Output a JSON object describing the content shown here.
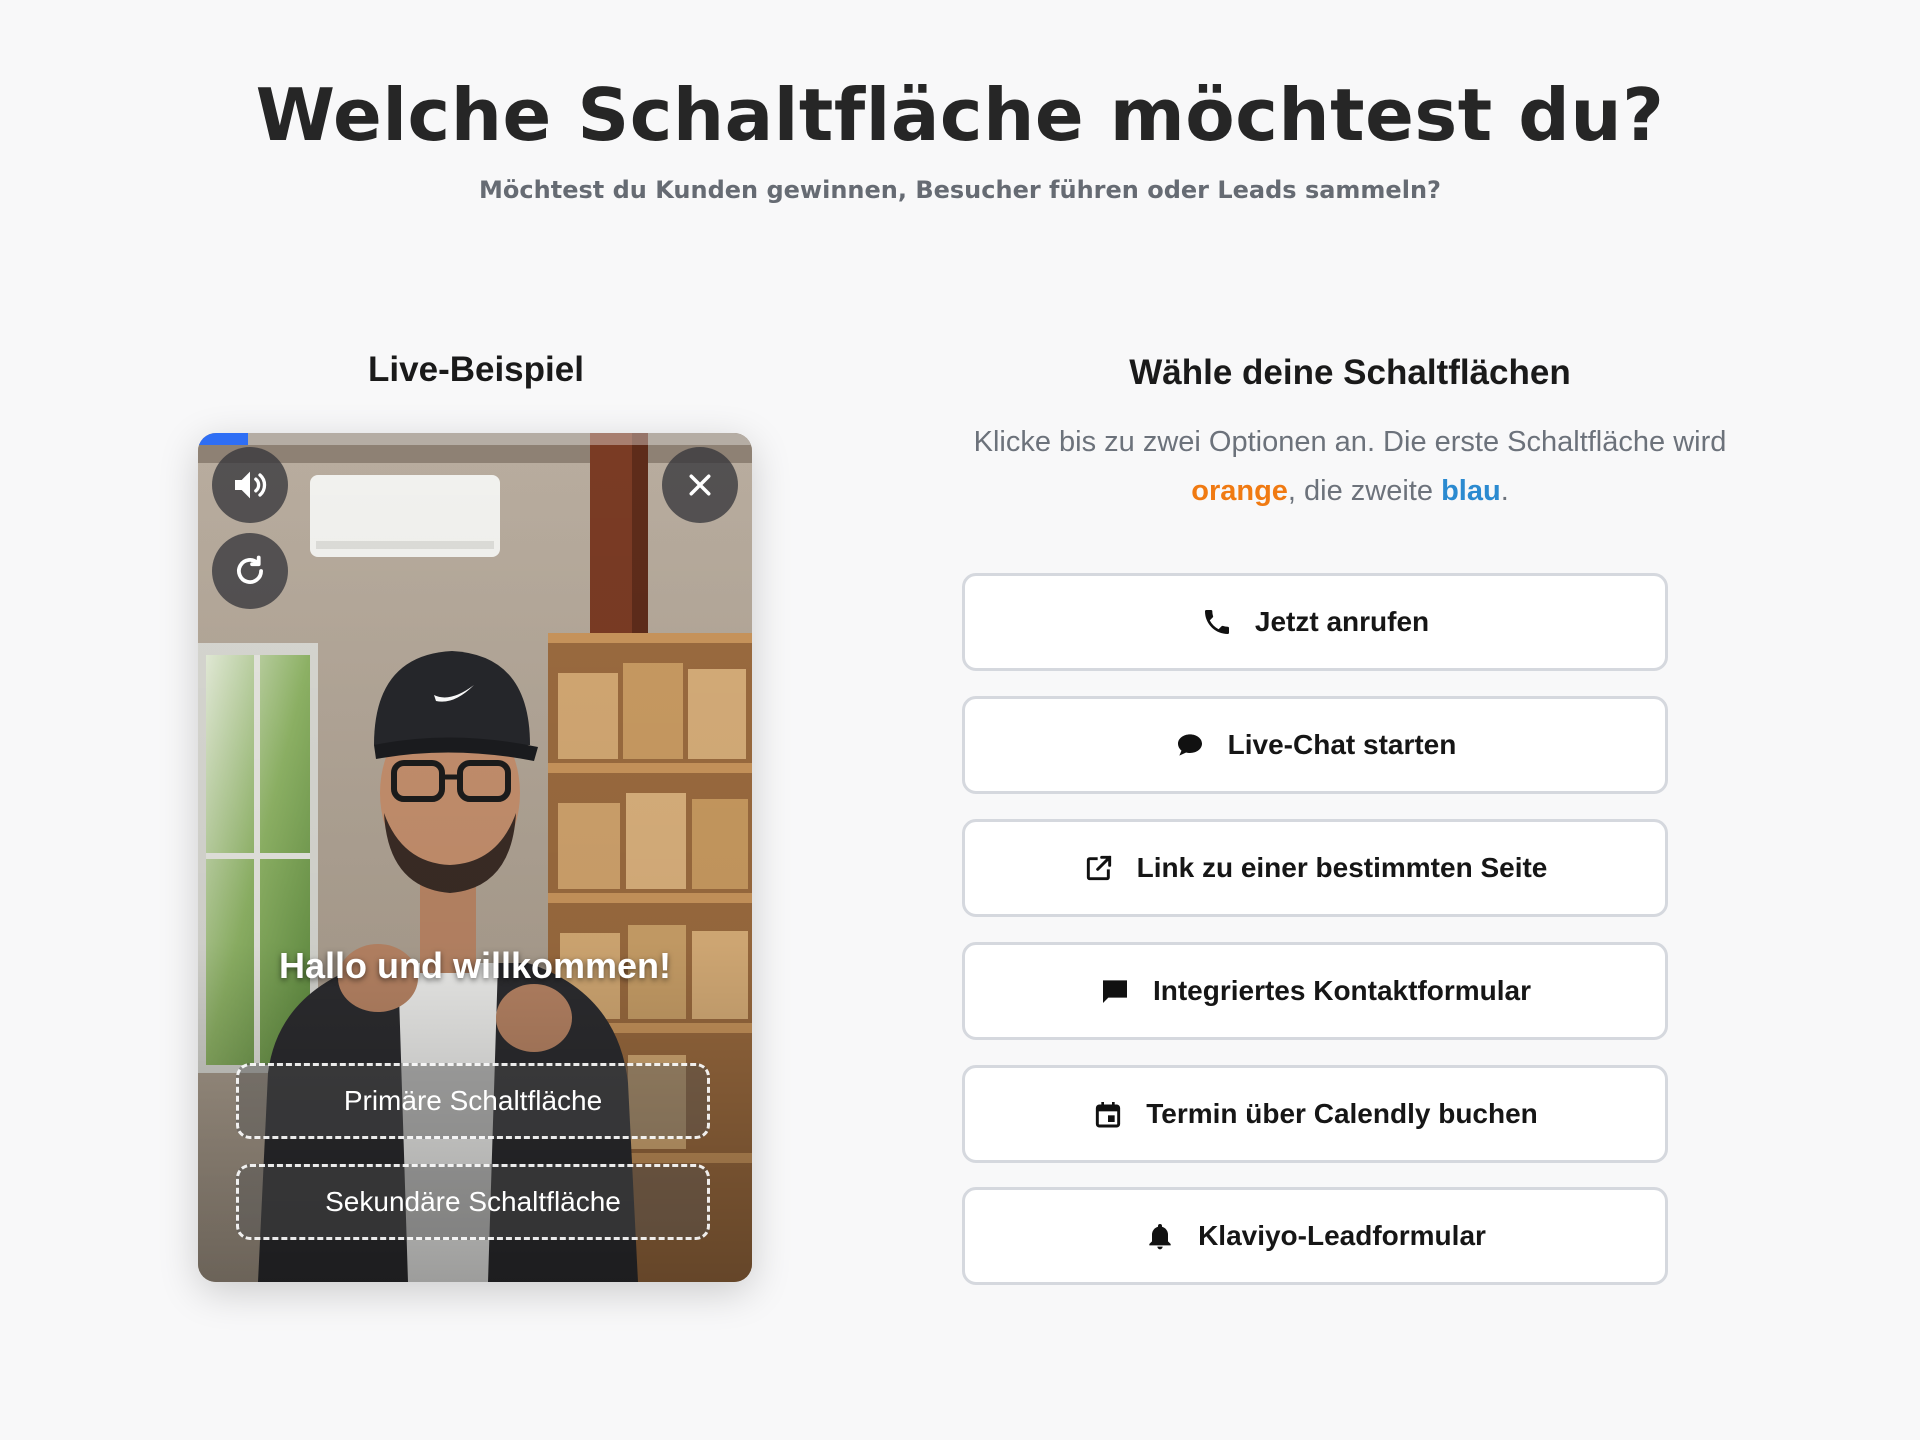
{
  "header": {
    "title": "Welche Schaltfläche möchtest du?",
    "subtitle": "Möchtest du Kunden gewinnen, Besucher führen oder Leads sammeln?"
  },
  "live_example": {
    "heading": "Live-Beispiel",
    "progress": 0.09,
    "caption": "Hallo und willkommen!",
    "primary_button": "Primäre Schaltfläche",
    "secondary_button": "Sekundäre Schaltfläche",
    "controls": {
      "sound_icon": "speaker-volume-icon",
      "replay_icon": "replay-icon",
      "close_icon": "close-icon"
    }
  },
  "chooser": {
    "heading": "Wähle deine Schaltflächen",
    "desc_part1": "Klicke bis zu zwei Optionen an. Die erste Schaltfläche wird ",
    "desc_orange": "orange",
    "desc_part2": ", die zweite ",
    "desc_blue": "blau",
    "desc_part3": ".",
    "colors": {
      "orange": "#f07a12",
      "blue": "#2b8ad0"
    },
    "options": [
      {
        "label": "Jetzt anrufen",
        "icon": "phone-icon"
      },
      {
        "label": "Live-Chat starten",
        "icon": "chat-bubble-icon"
      },
      {
        "label": "Link zu einer bestimmten Seite",
        "icon": "external-link-icon"
      },
      {
        "label": "Integriertes Kontaktformular",
        "icon": "message-icon"
      },
      {
        "label": "Termin über Calendly buchen",
        "icon": "calendar-icon"
      },
      {
        "label": "Klaviyo-Leadformular",
        "icon": "bell-icon"
      }
    ]
  }
}
